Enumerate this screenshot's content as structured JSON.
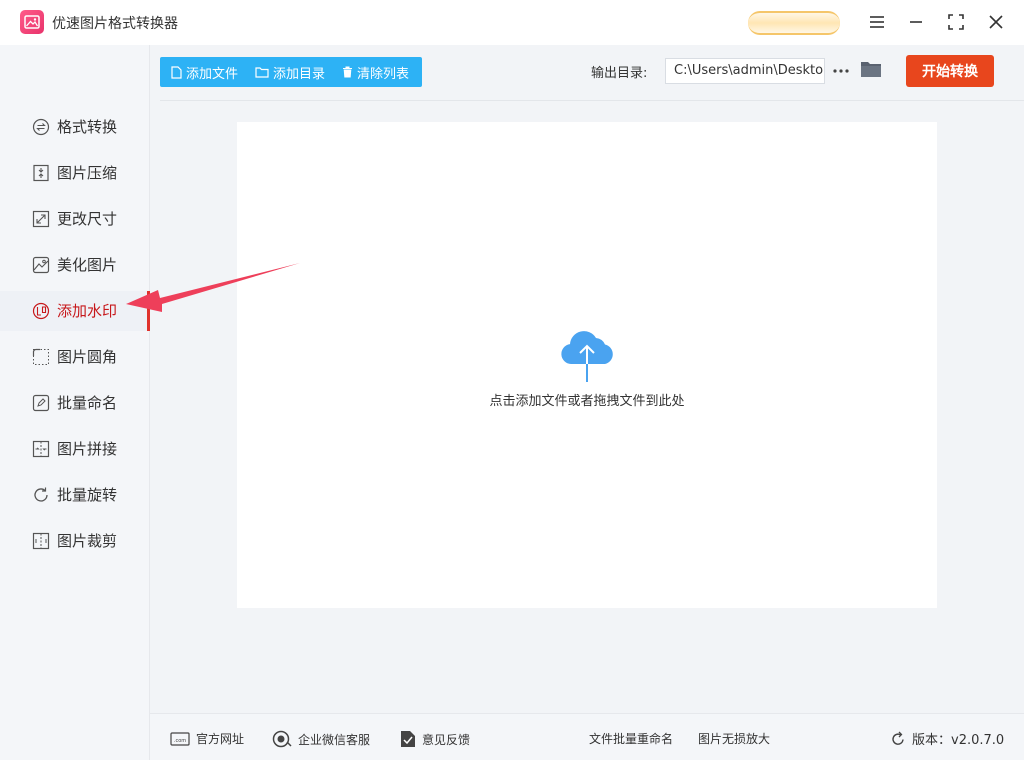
{
  "app": {
    "title": "优速图片格式转换器"
  },
  "sidebar": {
    "items": [
      {
        "label": "格式转换",
        "icon": "format-convert-icon"
      },
      {
        "label": "图片压缩",
        "icon": "compress-icon"
      },
      {
        "label": "更改尺寸",
        "icon": "resize-icon"
      },
      {
        "label": "美化图片",
        "icon": "beautify-icon"
      },
      {
        "label": "添加水印",
        "icon": "watermark-icon",
        "active": true
      },
      {
        "label": "图片圆角",
        "icon": "round-corner-icon"
      },
      {
        "label": "批量命名",
        "icon": "rename-icon"
      },
      {
        "label": "图片拼接",
        "icon": "stitch-icon"
      },
      {
        "label": "批量旋转",
        "icon": "rotate-icon"
      },
      {
        "label": "图片裁剪",
        "icon": "crop-icon"
      }
    ]
  },
  "toolbar": {
    "add_file": "添加文件",
    "add_folder": "添加目录",
    "clear_list": "清除列表",
    "output_label": "输出目录:",
    "output_path": "C:\\Users\\admin\\Deskto",
    "start": "开始转换"
  },
  "dropzone": {
    "hint": "点击添加文件或者拖拽文件到此处"
  },
  "footer": {
    "website": "官方网址",
    "wechat": "企业微信客服",
    "feedback": "意见反馈",
    "batch_rename": "文件批量重命名",
    "lossless": "图片无损放大",
    "version": "版本：v2.0.7.0"
  },
  "colors": {
    "accent_blue": "#2db2f5",
    "start_orange": "#e8461d",
    "active_red": "#c7181b",
    "arrow_red": "#ee3f5a",
    "cloud_blue": "#4aa3f0"
  }
}
